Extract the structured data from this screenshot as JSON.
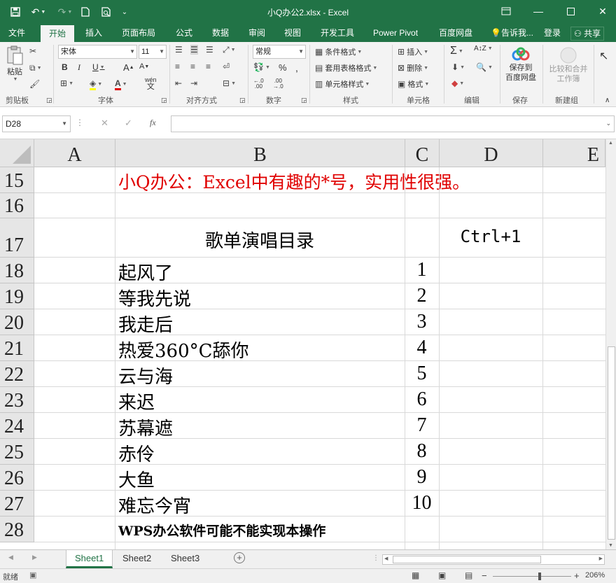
{
  "window": {
    "title": "小Q办公2.xlsx - Excel",
    "brand_color": "#217346"
  },
  "tabs": [
    {
      "label": "文件"
    },
    {
      "label": "开始"
    },
    {
      "label": "插入"
    },
    {
      "label": "页面布局"
    },
    {
      "label": "公式"
    },
    {
      "label": "数据"
    },
    {
      "label": "审阅"
    },
    {
      "label": "视图"
    },
    {
      "label": "开发工具"
    },
    {
      "label": "Power Pivot"
    },
    {
      "label": "百度网盘"
    },
    {
      "label": "告诉我..."
    },
    {
      "label": "登录"
    },
    {
      "label": "共享"
    }
  ],
  "ribbon": {
    "paste": "粘贴",
    "font_name": "宋体",
    "font_size": "11",
    "wen_label": "wén",
    "number_format": "常规",
    "conditional_format": "条件格式",
    "table_format": "套用表格格式",
    "cell_style": "单元格样式",
    "insert": "插入",
    "delete": "删除",
    "format": "格式",
    "save_to": "保存到",
    "baidu_pan": "百度网盘",
    "compare_merge_1": "比较和合并",
    "compare_merge_2": "工作簿",
    "groups": {
      "clipboard": "剪贴板",
      "font": "字体",
      "alignment": "对齐方式",
      "number": "数字",
      "styles": "样式",
      "cells": "单元格",
      "editing": "编辑",
      "save": "保存",
      "new_group": "新建组"
    }
  },
  "formula_bar": {
    "name_box": "D28",
    "fx": "fx",
    "content": ""
  },
  "grid": {
    "columns": [
      "A",
      "B",
      "C",
      "D",
      "E"
    ],
    "rows": [
      {
        "num": "15",
        "b": "小Q办公：Excel中有趣的*号，实用性很强。",
        "c": "",
        "d": ""
      },
      {
        "num": "16",
        "b": "",
        "c": "",
        "d": ""
      },
      {
        "num": "17",
        "b": "歌单演唱目录",
        "c": "",
        "d": "Ctrl+1"
      },
      {
        "num": "18",
        "b": "起风了",
        "c": "1",
        "d": ""
      },
      {
        "num": "19",
        "b": "等我先说",
        "c": "2",
        "d": ""
      },
      {
        "num": "20",
        "b": "我走后",
        "c": "3",
        "d": ""
      },
      {
        "num": "21",
        "b": "热爱360°C舔你",
        "c": "4",
        "d": ""
      },
      {
        "num": "22",
        "b": "云与海",
        "c": "5",
        "d": ""
      },
      {
        "num": "23",
        "b": "来迟",
        "c": "6",
        "d": ""
      },
      {
        "num": "24",
        "b": "苏幕遮",
        "c": "7",
        "d": ""
      },
      {
        "num": "25",
        "b": "赤伶",
        "c": "8",
        "d": ""
      },
      {
        "num": "26",
        "b": "大鱼",
        "c": "9",
        "d": ""
      },
      {
        "num": "27",
        "b": "难忘今宵",
        "c": "10",
        "d": ""
      },
      {
        "num": "28",
        "b": "WPS办公软件可能不能实现本操作",
        "c": "",
        "d": ""
      }
    ],
    "title_color": "#e00000"
  },
  "sheets": [
    {
      "label": "Sheet1"
    },
    {
      "label": "Sheet2"
    },
    {
      "label": "Sheet3"
    }
  ],
  "status": {
    "ready": "就绪",
    "zoom": "206%"
  }
}
